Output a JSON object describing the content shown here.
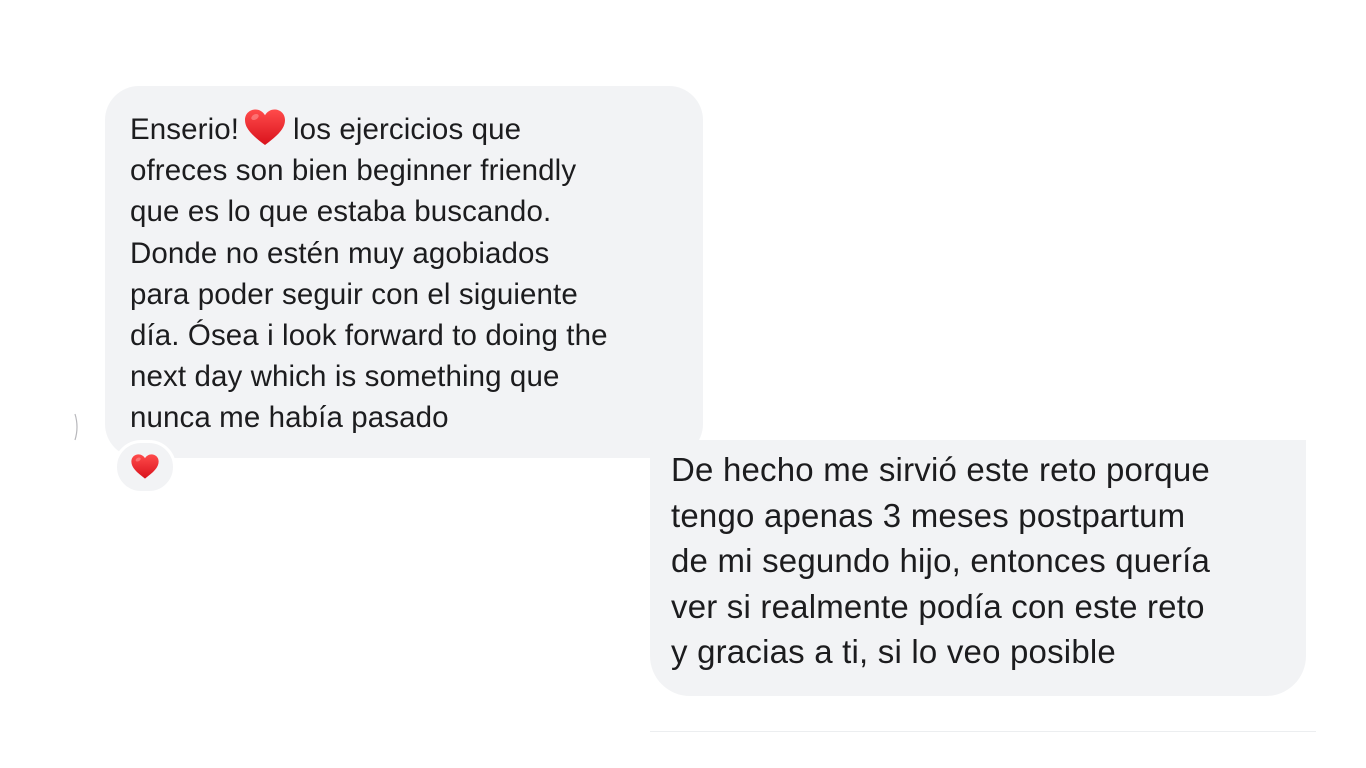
{
  "chat": {
    "messages": [
      {
        "sender": "other",
        "lines": [
          "Enserio!",
          "los ejercicios que",
          "ofreces son bien beginner friendly",
          "que es lo que estaba buscando.",
          "Donde no estén muy agobiados",
          "para poder seguir con el siguiente",
          "día. Ósea i look forward to doing the",
          "next day which is something que",
          "nunca me había pasado"
        ],
        "inline_icon": "red-heart-icon",
        "reaction": {
          "icon": "red-heart-icon",
          "color": "#e8202a"
        }
      },
      {
        "sender": "self",
        "lines": [
          "De hecho me sirvió este reto porque",
          "tengo apenas 3 meses postpartum",
          "de mi segundo hijo, entonces quería",
          "ver si realmente podía con este reto",
          "y gracias a ti, si lo veo posible"
        ]
      }
    ]
  },
  "colors": {
    "bubble_background": "#f2f3f5",
    "text": "#1c1c1e",
    "heart": "#e8202a",
    "page_background": "#ffffff"
  }
}
